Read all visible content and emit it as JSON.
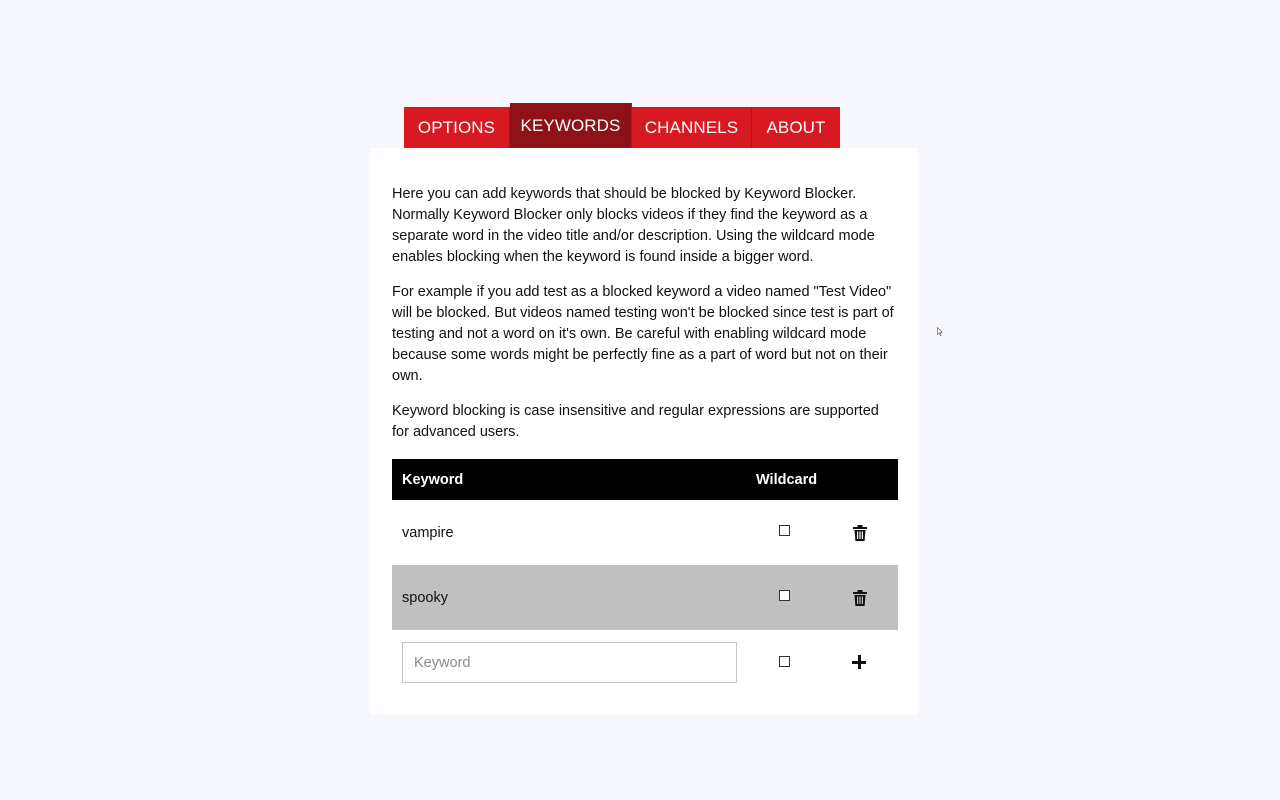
{
  "tabs": [
    {
      "label": "OPTIONS",
      "active": false
    },
    {
      "label": "KEYWORDS",
      "active": true
    },
    {
      "label": "CHANNELS",
      "active": false
    },
    {
      "label": "ABOUT",
      "active": false
    }
  ],
  "description": [
    "Here you can add keywords that should be blocked by Keyword Blocker. Normally Keyword Blocker only blocks videos if they find the keyword as a separate word in the video title and/or description. Using the wildcard mode enables blocking when the keyword is found inside a bigger word.",
    "For example if you add test as a blocked keyword a video named \"Test Video\" will be blocked. But videos named testing won't be blocked since test is part of testing and not a word on it's own. Be careful with enabling wildcard mode because some words might be perfectly fine as a part of word but not on their own.",
    "Keyword blocking is case insensitive and regular expressions are supported for advanced users."
  ],
  "table": {
    "headers": {
      "keyword": "Keyword",
      "wildcard": "Wildcard"
    },
    "rows": [
      {
        "keyword": "vampire",
        "wildcard": false
      },
      {
        "keyword": "spooky",
        "wildcard": false
      }
    ],
    "new_entry": {
      "placeholder": "Keyword",
      "value": "",
      "wildcard": false
    }
  },
  "icons": {
    "delete": "trash-icon",
    "add": "plus-icon"
  },
  "colors": {
    "tab": "#d81922",
    "tab_active": "#8f1218",
    "header_bg": "#000000",
    "row_highlight": "#c0c0c0",
    "page_bg": "#f7f8fe"
  }
}
